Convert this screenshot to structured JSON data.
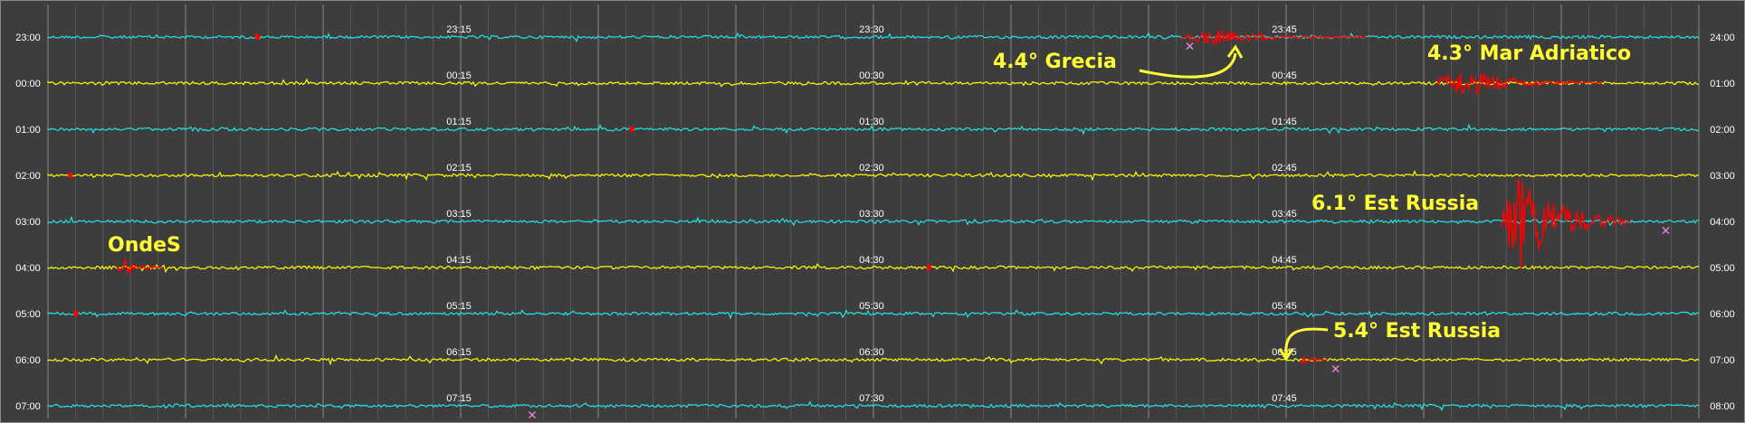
{
  "chart_data": {
    "type": "line",
    "title": "",
    "time_range": [
      "23:00",
      "08:00"
    ],
    "minutes_per_row": 60,
    "rows": [
      {
        "start": "23:00",
        "end": "24:00",
        "color": "#22e5e5",
        "mid_labels": [
          "23:15",
          "23:30",
          "23:45"
        ]
      },
      {
        "start": "00:00",
        "end": "01:00",
        "color": "#ffff00",
        "mid_labels": [
          "00:15",
          "00:30",
          "00:45"
        ]
      },
      {
        "start": "01:00",
        "end": "02:00",
        "color": "#22e5e5",
        "mid_labels": [
          "01:15",
          "01:30",
          "01:45"
        ]
      },
      {
        "start": "02:00",
        "end": "03:00",
        "color": "#ffff00",
        "mid_labels": [
          "02:15",
          "02:30",
          "02:45"
        ]
      },
      {
        "start": "03:00",
        "end": "04:00",
        "color": "#22e5e5",
        "mid_labels": [
          "03:15",
          "03:30",
          "03:45"
        ]
      },
      {
        "start": "04:00",
        "end": "05:00",
        "color": "#ffff00",
        "mid_labels": [
          "04:15",
          "04:30",
          "04:45"
        ]
      },
      {
        "start": "05:00",
        "end": "06:00",
        "color": "#22e5e5",
        "mid_labels": [
          "05:15",
          "05:30",
          "05:45"
        ]
      },
      {
        "start": "06:00",
        "end": "07:00",
        "color": "#ffff00",
        "mid_labels": [
          "06:15",
          "06:30",
          "06:45"
        ]
      },
      {
        "start": "07:00",
        "end": "08:00",
        "color": "#22e5e5",
        "mid_labels": [
          "07:15",
          "07:30",
          "07:45"
        ]
      }
    ],
    "events": [
      {
        "label": "4.4° Grecia",
        "row": 0,
        "start_min": 41.2,
        "end_min": 48.0,
        "amplitude": 9,
        "marker_min": 41.5
      },
      {
        "label": "4.3° Mar Adriatico",
        "row": 1,
        "start_min": 50.5,
        "end_min": 56.5,
        "amplitude": 16
      },
      {
        "label": "6.1° Est Russia",
        "row": 4,
        "start_min": 52.8,
        "end_min": 57.5,
        "amplitude": 55,
        "marker_min": 58.8
      },
      {
        "label": "OndeS",
        "row": 5,
        "start_min": 2.5,
        "end_min": 4.2,
        "amplitude": 10
      },
      {
        "label": "5.4° Est Russia",
        "row": 7,
        "start_min": 45.5,
        "end_min": 46.5,
        "amplitude": 6,
        "marker_min": 46.8
      }
    ],
    "red_ticks": [
      {
        "row": 0,
        "min": 7.6
      },
      {
        "row": 2,
        "min": 21.2
      },
      {
        "row": 3,
        "min": 0.8
      },
      {
        "row": 5,
        "min": 32.0
      },
      {
        "row": 6,
        "min": 1.0
      }
    ],
    "markers_x": [
      {
        "row": 8,
        "min": 17.6
      }
    ],
    "grid": true,
    "colors": {
      "background": "#3d3d3d",
      "grid": "#9a9a9a",
      "event": "#ff0000",
      "annotation": "#ffff33",
      "marker": "#ee88ee"
    }
  }
}
